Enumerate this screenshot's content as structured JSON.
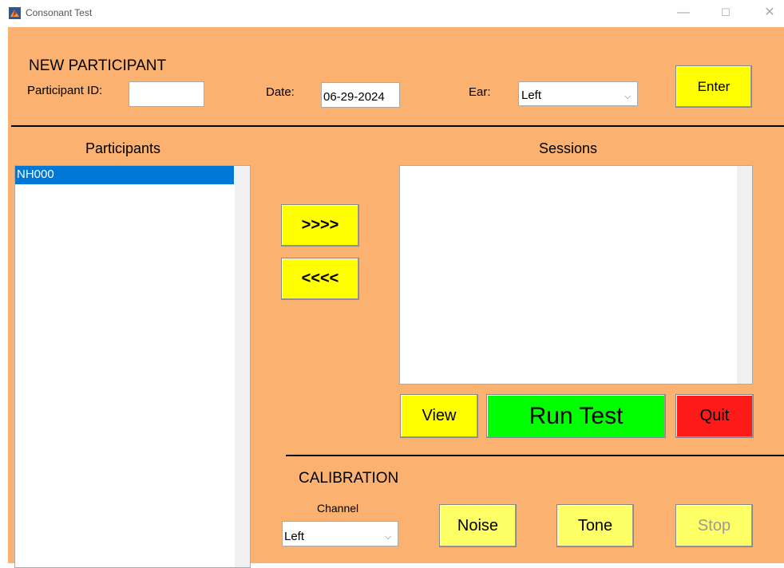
{
  "window": {
    "title": "Consonant Test",
    "controls": [
      "—",
      "☐",
      "✕"
    ]
  },
  "new_participant": {
    "heading": "NEW PARTICIPANT",
    "participant_id_label": "Participant ID:",
    "participant_id_value": "",
    "date_label": "Date:",
    "date_value": "06-29-2024",
    "ear_label": "Ear:",
    "ear_value": "Left",
    "enter_label": "Enter"
  },
  "participants": {
    "heading": "Participants",
    "items": [
      "NH000"
    ],
    "selected_index": 0
  },
  "transfer": {
    "add_label": ">>>>",
    "remove_label": "<<<<"
  },
  "sessions": {
    "heading": "Sessions",
    "items": []
  },
  "actions": {
    "view_label": "View",
    "run_label": "Run Test",
    "quit_label": "Quit"
  },
  "calibration": {
    "heading": "CALIBRATION",
    "channel_label": "Channel",
    "channel_value": "Left",
    "noise_label": "Noise",
    "tone_label": "Tone",
    "stop_label": "Stop",
    "stop_enabled": false
  },
  "colors": {
    "background": "#fbb16f",
    "yellow": "#ffff00",
    "pale_yellow": "#ffff66",
    "green": "#00ff00",
    "red": "#ff1a1a",
    "selection": "#0078d7"
  }
}
